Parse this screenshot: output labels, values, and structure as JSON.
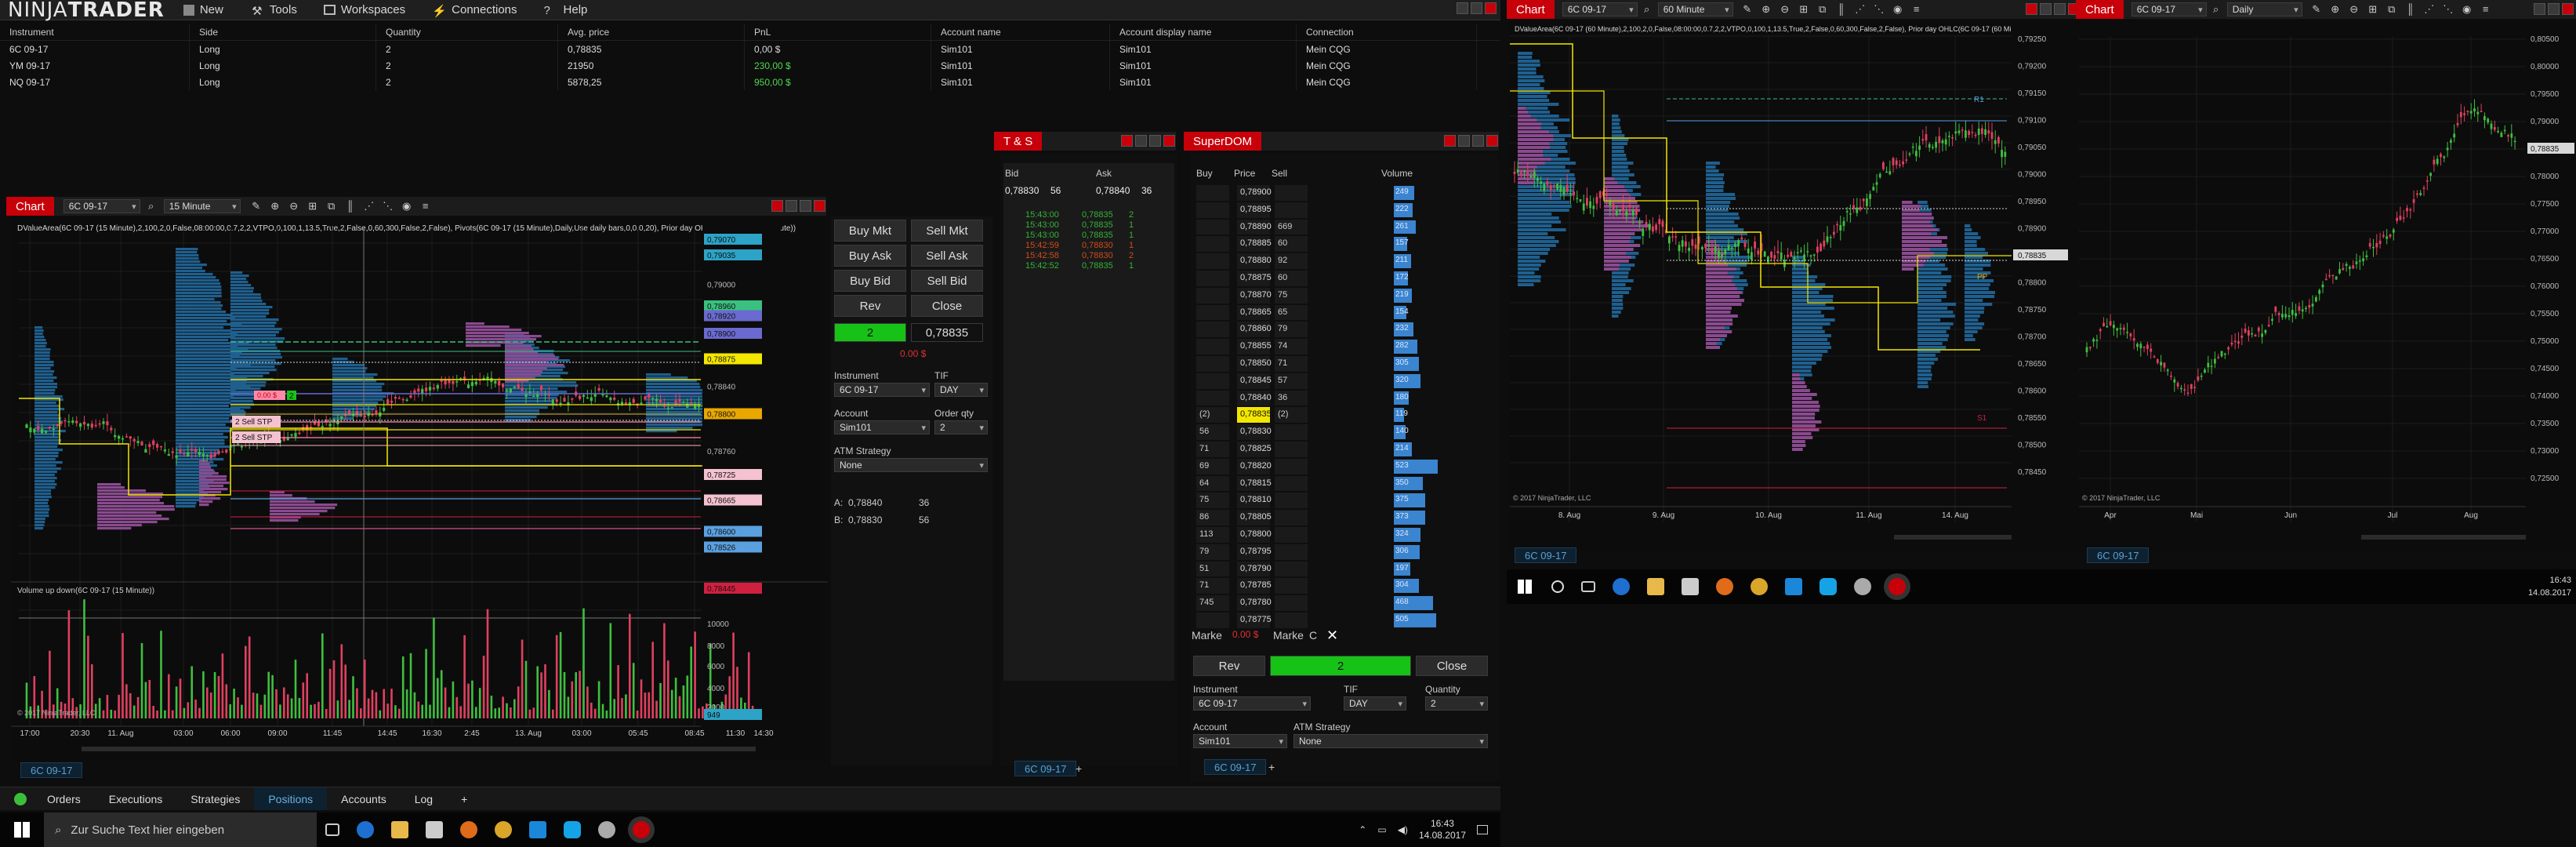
{
  "menubar": {
    "logo_a": "NINJA",
    "logo_b": "TRADER",
    "items": [
      "New",
      "Tools",
      "Workspaces",
      "Connections",
      "Help"
    ]
  },
  "positions": {
    "headers": [
      "Instrument",
      "Side",
      "Quantity",
      "Avg. price",
      "PnL",
      "Account name",
      "Account display name",
      "Connection"
    ],
    "rows": [
      [
        "6C 09-17",
        "Long",
        "2",
        "0,78835",
        "0,00 $",
        "Sim101",
        "Sim101",
        "Mein CQG"
      ],
      [
        "YM 09-17",
        "Long",
        "2",
        "21950",
        "230,00 $",
        "Sim101",
        "Sim101",
        "Mein CQG"
      ],
      [
        "NQ 09-17",
        "Long",
        "2",
        "5878,25",
        "950,00 $",
        "Sim101",
        "Sim101",
        "Mein CQG"
      ]
    ],
    "pnl_colors": [
      "#d8d8d8",
      "#4cd94c",
      "#4cd94c"
    ]
  },
  "chart1": {
    "tab": "Chart",
    "instrument": "6C 09-17",
    "interval": "15 Minute",
    "indicator_line": "DValueArea(6C 09-17 (15 Minute),2,100,2,0,False,08:00:00,0.7,2,2,VTPO,0,100,1,13.5,True,2,False,0,60,300,False,2,False), Pivots(6C 09-17 (15 Minute),Daily,Use daily bars,0,0,0,20), Prior day OHLC(6C 09-17 (15 Minute))",
    "volume_label": "Volume up down(6C 09-17 (15 Minute))",
    "copyright": "© 2017 NinjaTrader, LLC",
    "prices": [
      "0,79070",
      "0,79035",
      "0,79000",
      "0,78960",
      "0,78920",
      "0,78900",
      "0,78875",
      "0,78840",
      "0,78800",
      "0,78760",
      "0,78725",
      "0,78665",
      "0,78600",
      "0,78526",
      "0,78445"
    ],
    "vol_ticks": [
      "10000",
      "8000",
      "6000",
      "4000",
      "2000",
      "949"
    ],
    "x_labels": [
      "17:00",
      "20:30",
      "11. Aug",
      "03:00",
      "06:00",
      "09:00",
      "11:45",
      "14:45",
      "16:30",
      "2:45",
      "13. Aug",
      "03:00",
      "05:45",
      "08:45",
      "11:30",
      "14:30"
    ],
    "orders": [
      "2 Sell STP",
      "2 Sell STP"
    ],
    "order_label": "0.00 $",
    "order_qty": "2",
    "bottom_tab": "6C 09-17"
  },
  "chart_trader": {
    "buy_mkt": "Buy Mkt",
    "sell_mkt": "Sell Mkt",
    "buy_ask": "Buy Ask",
    "sell_ask": "Sell Ask",
    "buy_bid": "Buy Bid",
    "sell_bid": "Sell Bid",
    "rev": "Rev",
    "close": "Close",
    "qty": "2",
    "price": "0,78835",
    "pnl": "0.00 $",
    "instrument_lbl": "Instrument",
    "instrument": "6C 09-17",
    "tif_lbl": "TIF",
    "tif": "DAY",
    "account_lbl": "Account",
    "account": "Sim101",
    "qty_lbl": "Order qty",
    "qty2": "2",
    "atm_lbl": "ATM Strategy",
    "atm": "None",
    "ask_lbl": "A:",
    "ask": "0,78840",
    "ask_sz": "36",
    "bid_lbl": "B:",
    "bid": "0,78830",
    "bid_sz": "56"
  },
  "ts": {
    "title": "T & S",
    "bid_h": "Bid",
    "ask_h": "Ask",
    "bid": "0,78830",
    "bid_sz": "56",
    "ask": "0,78840",
    "ask_sz": "36",
    "rows": [
      {
        "t": "15:43:00",
        "p": "0,78835",
        "q": "2",
        "c": "#36b236"
      },
      {
        "t": "15:43:00",
        "p": "0,78835",
        "q": "1",
        "c": "#36b236"
      },
      {
        "t": "15:43:00",
        "p": "0,78835",
        "q": "1",
        "c": "#36b236"
      },
      {
        "t": "15:42:59",
        "p": "0,78830",
        "q": "1",
        "c": "#d24a1c"
      },
      {
        "t": "15:42:58",
        "p": "0,78830",
        "q": "2",
        "c": "#d24a1c"
      },
      {
        "t": "15:42:52",
        "p": "0,78835",
        "q": "1",
        "c": "#36b236"
      }
    ],
    "bottom_tab": "6C 09-17"
  },
  "superdom": {
    "title": "SuperDOM",
    "buy_h": "Buy",
    "price_h": "Price",
    "sell_h": "Sell",
    "vol_h": "Volume",
    "rows": [
      {
        "b": "",
        "p": "0,78900",
        "s": "",
        "v": "249"
      },
      {
        "b": "",
        "p": "0,78895",
        "s": "",
        "v": "222"
      },
      {
        "b": "",
        "p": "0,78890",
        "s": "669",
        "v": "261"
      },
      {
        "b": "",
        "p": "0,78885",
        "s": "60",
        "v": "157"
      },
      {
        "b": "",
        "p": "0,78880",
        "s": "92",
        "v": "211"
      },
      {
        "b": "",
        "p": "0,78875",
        "s": "60",
        "v": "172"
      },
      {
        "b": "",
        "p": "0,78870",
        "s": "75",
        "v": "219"
      },
      {
        "b": "",
        "p": "0,78865",
        "s": "65",
        "v": "154"
      },
      {
        "b": "",
        "p": "0,78860",
        "s": "79",
        "v": "232"
      },
      {
        "b": "",
        "p": "0,78855",
        "s": "74",
        "v": "282"
      },
      {
        "b": "",
        "p": "0,78850",
        "s": "71",
        "v": "305"
      },
      {
        "b": "",
        "p": "0,78845",
        "s": "57",
        "v": "320"
      },
      {
        "b": "",
        "p": "0,78840",
        "s": "36",
        "v": "180"
      },
      {
        "b": "(2)",
        "p": "0,78835",
        "s": "(2)",
        "v": "119"
      },
      {
        "b": "56",
        "p": "0,78830",
        "s": "",
        "v": "140"
      },
      {
        "b": "71",
        "p": "0,78825",
        "s": "",
        "v": "214"
      },
      {
        "b": "69",
        "p": "0,78820",
        "s": "",
        "v": "523"
      },
      {
        "b": "64",
        "p": "0,78815",
        "s": "",
        "v": "350"
      },
      {
        "b": "75",
        "p": "0,78810",
        "s": "",
        "v": "375"
      },
      {
        "b": "86",
        "p": "0,78805",
        "s": "",
        "v": "373"
      },
      {
        "b": "113",
        "p": "0,78800",
        "s": "",
        "v": "324"
      },
      {
        "b": "79",
        "p": "0,78795",
        "s": "",
        "v": "306"
      },
      {
        "b": "51",
        "p": "0,78790",
        "s": "",
        "v": "197"
      },
      {
        "b": "71",
        "p": "0,78785",
        "s": "",
        "v": "304"
      },
      {
        "b": "745",
        "p": "0,78780",
        "s": "",
        "v": "468"
      },
      {
        "b": "",
        "p": "0,78775",
        "s": "",
        "v": "505"
      }
    ],
    "marke": "Marke",
    "pnl": "0.00 $",
    "marke2": "Marke",
    "c": "C",
    "rev": "Rev",
    "qty": "2",
    "close": "Close",
    "instrument_lbl": "Instrument",
    "instrument": "6C 09-17",
    "tif_lbl": "TIF",
    "tif": "DAY",
    "quantity_lbl": "Quantity",
    "quantity": "2",
    "account_lbl": "Account",
    "account": "Sim101",
    "atm_lbl": "ATM Strategy",
    "atm": "None",
    "bottom_tab": "6C 09-17"
  },
  "chart2": {
    "tab": "Chart",
    "instrument": "6C 09-17",
    "interval": "60 Minute",
    "indicator_line": "DValueArea(6C 09-17 (60 Minute),2,100,2,0,False,08:00:00,0.7,2,2,VTPO,0,100,1,13.5,True,2,False,0,60,300,False,2,False), Prior day OHLC(6C 09-17 (60 Minute)), Pivots(6C 09-17 (60 Minute),Daily,Use daily bars,0,0,0,20)",
    "prices": [
      "0,79250",
      "0,79200",
      "0,79150",
      "0,79100",
      "0,79050",
      "0,79000",
      "0,78950",
      "0,78900",
      "0,78835",
      "0,78800",
      "0,78750",
      "0,78700",
      "0,78650",
      "0,78600",
      "0,78550",
      "0,78500",
      "0,78450"
    ],
    "x_labels": [
      "8. Aug",
      "9. Aug",
      "10. Aug",
      "11. Aug",
      "14. Aug"
    ],
    "copyright": "© 2017 NinjaTrader, LLC",
    "bottom_tab": "6C 09-17",
    "pivot_labels": [
      "R1",
      "PP",
      "S1"
    ]
  },
  "chart3": {
    "tab": "Chart",
    "instrument": "6C 09-17",
    "interval": "Daily",
    "prices": [
      "0,80500",
      "0,80000",
      "0,79500",
      "0,79000",
      "0,78835",
      "0,78000",
      "0,77500",
      "0,77000",
      "0,76500",
      "0,76000",
      "0,75500",
      "0,75000",
      "0,74500",
      "0,74000",
      "0,73500",
      "0,73000",
      "0,72500"
    ],
    "x_labels": [
      "Apr",
      "Mai",
      "Jun",
      "Jul",
      "Aug"
    ],
    "copyright": "© 2017 NinjaTrader, LLC",
    "bottom_tab": "6C 09-17"
  },
  "bottom_tabs": [
    "Orders",
    "Executions",
    "Strategies",
    "Positions",
    "Accounts",
    "Log"
  ],
  "taskbar": {
    "search": "Zur Suche Text hier eingeben",
    "time": "16:43",
    "date": "14.08.2017"
  },
  "taskbar2": {
    "time": "16:43",
    "date": "14.08.2017"
  },
  "colors": {
    "accent_red": "#c8000a",
    "buy_green": "#17c217",
    "price_yellow": "#f3e600",
    "vol_blue": "#1f5f8e",
    "profile_purple": "#8a4a8f"
  }
}
